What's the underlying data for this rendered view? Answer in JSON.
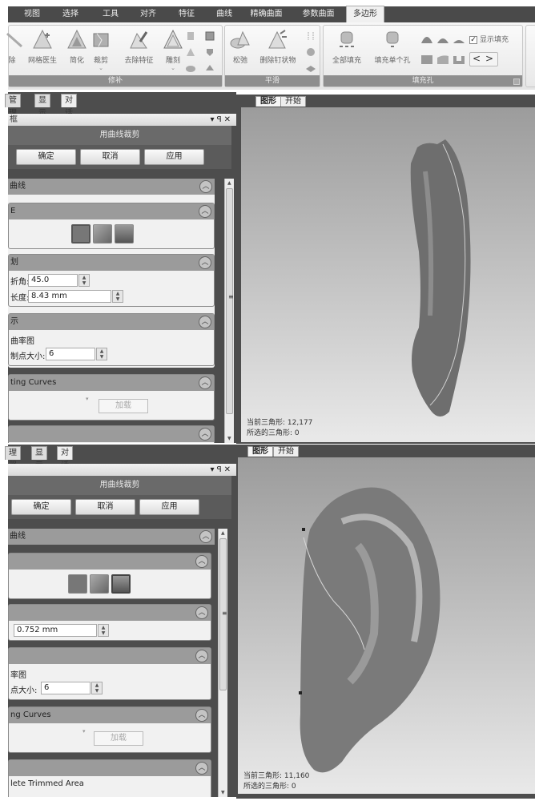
{
  "menu": {
    "tabs": [
      "视图",
      "选择",
      "工具",
      "对齐",
      "特征",
      "曲线",
      "精确曲面",
      "参数曲面",
      "多边形"
    ],
    "active_tab": "多边形"
  },
  "ribbon": {
    "groups": [
      {
        "label": "修补",
        "buttons": [
          "除",
          "网格医生",
          "简化",
          "裁剪",
          "去除特征",
          "雕刻"
        ]
      },
      {
        "label": "平滑",
        "buttons": [
          "松弛",
          "删除钉状物"
        ]
      },
      {
        "label": "填充孔",
        "buttons": [
          "全部填充",
          "填充单个孔"
        ],
        "checkbox": {
          "label": "显示填充",
          "checked": true
        },
        "nav": [
          "<",
          ">"
        ]
      }
    ]
  },
  "top_panel": {
    "tabs": [
      "管理器",
      "显示",
      "对话框"
    ],
    "active_tab": "对话框",
    "title_bar": "框",
    "dialog_title": "用曲线裁剪",
    "buttons": {
      "ok": "确定",
      "cancel": "取消",
      "apply": "应用"
    },
    "sections": {
      "curve": "曲线",
      "mode": "E",
      "mode_selected": 0,
      "split": "划",
      "angle_label": "折角:",
      "angle_value": "45.0",
      "length_label": "长度:",
      "length_value": "8.43 mm",
      "display": "示",
      "curvature_label": "曲率图",
      "point_size_label": "制点大小:",
      "point_size_value": "6",
      "existing": "ting Curves",
      "load": "加载"
    }
  },
  "bottom_panel": {
    "tabs": [
      "理器",
      "显示",
      "对话框"
    ],
    "active_tab": "对话框",
    "dialog_title": "用曲线裁剪",
    "buttons": {
      "ok": "确定",
      "cancel": "取消",
      "apply": "应用"
    },
    "sections": {
      "curve": "曲线",
      "mode_selected": 2,
      "length_value": "0.752 mm",
      "curvature_label": "率图",
      "point_size_label": "点大小:",
      "point_size_value": "6",
      "existing": "ng Curves",
      "load": "加载",
      "delete_trimmed": "lete Trimmed Area"
    }
  },
  "top_view": {
    "tabs": [
      "图形",
      "开始"
    ],
    "active_tab": "图形",
    "current_triangles_label": "当前三角形:",
    "current_triangles": "12,177",
    "selected_triangles_label": "所选的三角形:",
    "selected_triangles": "0"
  },
  "bottom_view": {
    "tabs": [
      "图形",
      "开始"
    ],
    "active_tab": "图形",
    "current_triangles_label": "当前三角形:",
    "current_triangles": "11,160",
    "selected_triangles_label": "所选的三角形:",
    "selected_triangles": "0"
  }
}
